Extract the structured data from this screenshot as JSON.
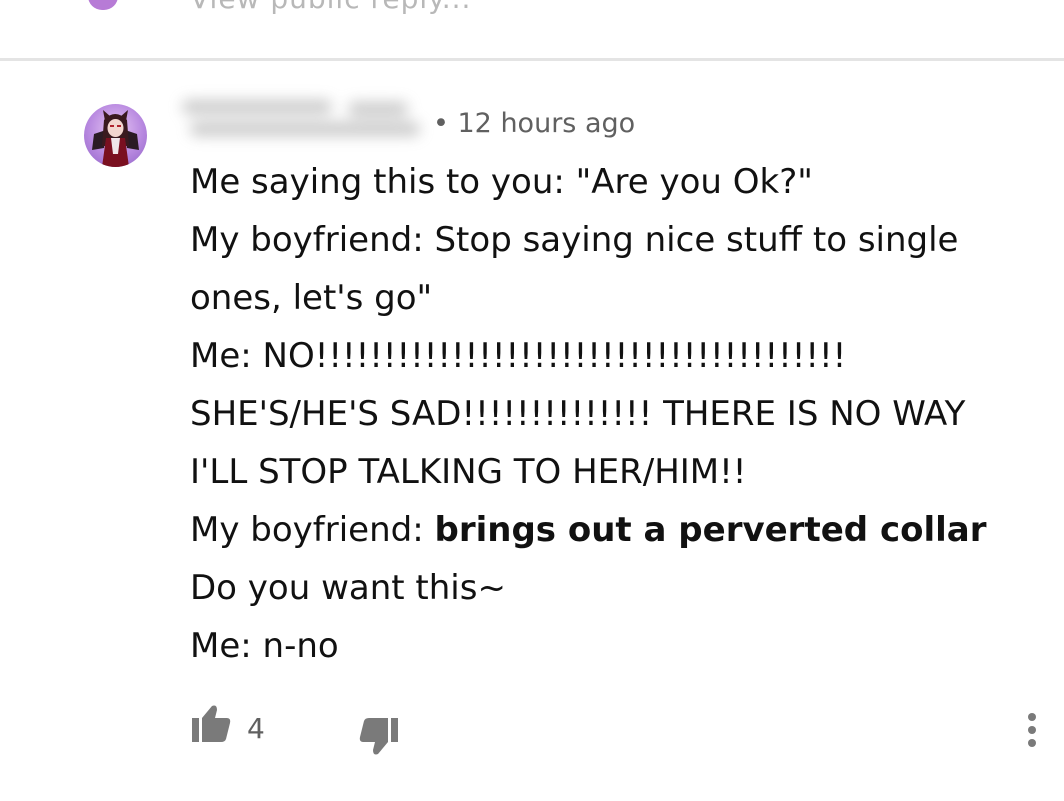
{
  "previous_comment": {
    "reply_link_partial": "View public reply..."
  },
  "comment": {
    "timestamp": "• 12 hours ago",
    "body": {
      "line1": "Me saying this to you: \"Are you Ok?\"",
      "line2": "My boyfriend: Stop saying nice stuff to single ones, let's go\"",
      "line3": "Me: NO!!!!!!!!!!!!!!!!!!!!!!!!!!!!!!!!!!!!!!! SHE'S/HE'S SAD!!!!!!!!!!!!!! THERE IS NO WAY I'LL STOP TALKING TO HER/HIM!!",
      "line4_prefix": "My boyfriend: ",
      "line4_bold": "brings out a perverted collar",
      "line4_suffix": " Do you want this~",
      "line5": "Me: n-no"
    },
    "likes": "4",
    "icons": {
      "like": "thumbs-up-icon",
      "dislike": "thumbs-down-icon",
      "more": "more-vertical-icon"
    },
    "colors": {
      "icon": "#7a7a7a",
      "meta_text": "#606060",
      "divider": "#e4e4e4"
    }
  }
}
